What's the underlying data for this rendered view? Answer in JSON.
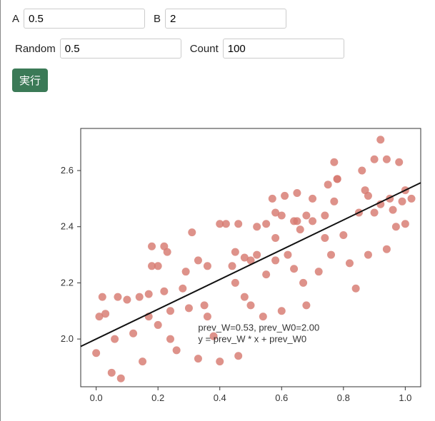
{
  "form": {
    "a_label": "A",
    "a_value": "0.5",
    "b_label": "B",
    "b_value": "2",
    "random_label": "Random",
    "random_value": "0.5",
    "count_label": "Count",
    "count_value": "100",
    "run_label": "実行"
  },
  "chart_data": {
    "type": "scatter",
    "xlabel": "",
    "ylabel": "",
    "xlim": [
      -0.05,
      1.05
    ],
    "ylim": [
      1.83,
      2.75
    ],
    "x_ticks": [
      0.0,
      0.2,
      0.4,
      0.6,
      0.8,
      1.0
    ],
    "y_ticks": [
      2.0,
      2.2,
      2.4,
      2.6
    ],
    "annotation_line1": "prev_W=0.53, prev_W0=2.00",
    "annotation_line2": "y = prev_W * x + prev_W0",
    "fit": {
      "slope": 0.53,
      "intercept": 2.0
    },
    "series": [
      {
        "name": "data",
        "color": "#d77a70",
        "points": [
          [
            0.0,
            1.95
          ],
          [
            0.01,
            2.08
          ],
          [
            0.02,
            2.15
          ],
          [
            0.03,
            2.09
          ],
          [
            0.05,
            1.88
          ],
          [
            0.06,
            2.0
          ],
          [
            0.07,
            2.15
          ],
          [
            0.08,
            1.86
          ],
          [
            0.1,
            2.14
          ],
          [
            0.12,
            2.02
          ],
          [
            0.14,
            2.15
          ],
          [
            0.15,
            1.92
          ],
          [
            0.17,
            2.08
          ],
          [
            0.17,
            2.16
          ],
          [
            0.18,
            2.33
          ],
          [
            0.18,
            2.26
          ],
          [
            0.2,
            2.26
          ],
          [
            0.2,
            2.05
          ],
          [
            0.22,
            2.33
          ],
          [
            0.22,
            2.17
          ],
          [
            0.23,
            2.31
          ],
          [
            0.24,
            2.1
          ],
          [
            0.24,
            2.0
          ],
          [
            0.26,
            1.96
          ],
          [
            0.28,
            2.18
          ],
          [
            0.29,
            2.24
          ],
          [
            0.3,
            2.11
          ],
          [
            0.31,
            2.38
          ],
          [
            0.33,
            1.93
          ],
          [
            0.33,
            2.28
          ],
          [
            0.35,
            2.12
          ],
          [
            0.36,
            2.08
          ],
          [
            0.36,
            2.26
          ],
          [
            0.38,
            2.01
          ],
          [
            0.4,
            2.41
          ],
          [
            0.4,
            1.92
          ],
          [
            0.42,
            2.41
          ],
          [
            0.44,
            2.26
          ],
          [
            0.45,
            2.2
          ],
          [
            0.45,
            2.31
          ],
          [
            0.46,
            2.41
          ],
          [
            0.46,
            1.94
          ],
          [
            0.48,
            2.15
          ],
          [
            0.48,
            2.29
          ],
          [
            0.5,
            2.28
          ],
          [
            0.5,
            2.12
          ],
          [
            0.52,
            2.4
          ],
          [
            0.52,
            2.3
          ],
          [
            0.54,
            2.08
          ],
          [
            0.55,
            2.23
          ],
          [
            0.55,
            2.41
          ],
          [
            0.57,
            2.5
          ],
          [
            0.58,
            2.45
          ],
          [
            0.58,
            2.36
          ],
          [
            0.58,
            2.28
          ],
          [
            0.6,
            2.44
          ],
          [
            0.6,
            2.1
          ],
          [
            0.61,
            2.51
          ],
          [
            0.62,
            2.3
          ],
          [
            0.64,
            2.42
          ],
          [
            0.64,
            2.25
          ],
          [
            0.65,
            2.52
          ],
          [
            0.65,
            2.42
          ],
          [
            0.66,
            2.39
          ],
          [
            0.67,
            2.2
          ],
          [
            0.68,
            2.12
          ],
          [
            0.68,
            2.44
          ],
          [
            0.7,
            2.5
          ],
          [
            0.7,
            2.42
          ],
          [
            0.72,
            2.24
          ],
          [
            0.74,
            2.44
          ],
          [
            0.74,
            2.36
          ],
          [
            0.75,
            2.55
          ],
          [
            0.76,
            2.3
          ],
          [
            0.77,
            2.49
          ],
          [
            0.77,
            2.63
          ],
          [
            0.78,
            2.57
          ],
          [
            0.78,
            2.57
          ],
          [
            0.8,
            2.37
          ],
          [
            0.82,
            2.27
          ],
          [
            0.84,
            2.18
          ],
          [
            0.85,
            2.45
          ],
          [
            0.86,
            2.6
          ],
          [
            0.87,
            2.53
          ],
          [
            0.88,
            2.3
          ],
          [
            0.88,
            2.51
          ],
          [
            0.9,
            2.45
          ],
          [
            0.9,
            2.64
          ],
          [
            0.92,
            2.71
          ],
          [
            0.92,
            2.48
          ],
          [
            0.94,
            2.32
          ],
          [
            0.94,
            2.64
          ],
          [
            0.95,
            2.5
          ],
          [
            0.96,
            2.46
          ],
          [
            0.97,
            2.4
          ],
          [
            0.98,
            2.63
          ],
          [
            0.99,
            2.49
          ],
          [
            1.0,
            2.53
          ],
          [
            1.0,
            2.41
          ],
          [
            1.02,
            2.5
          ]
        ]
      }
    ]
  }
}
